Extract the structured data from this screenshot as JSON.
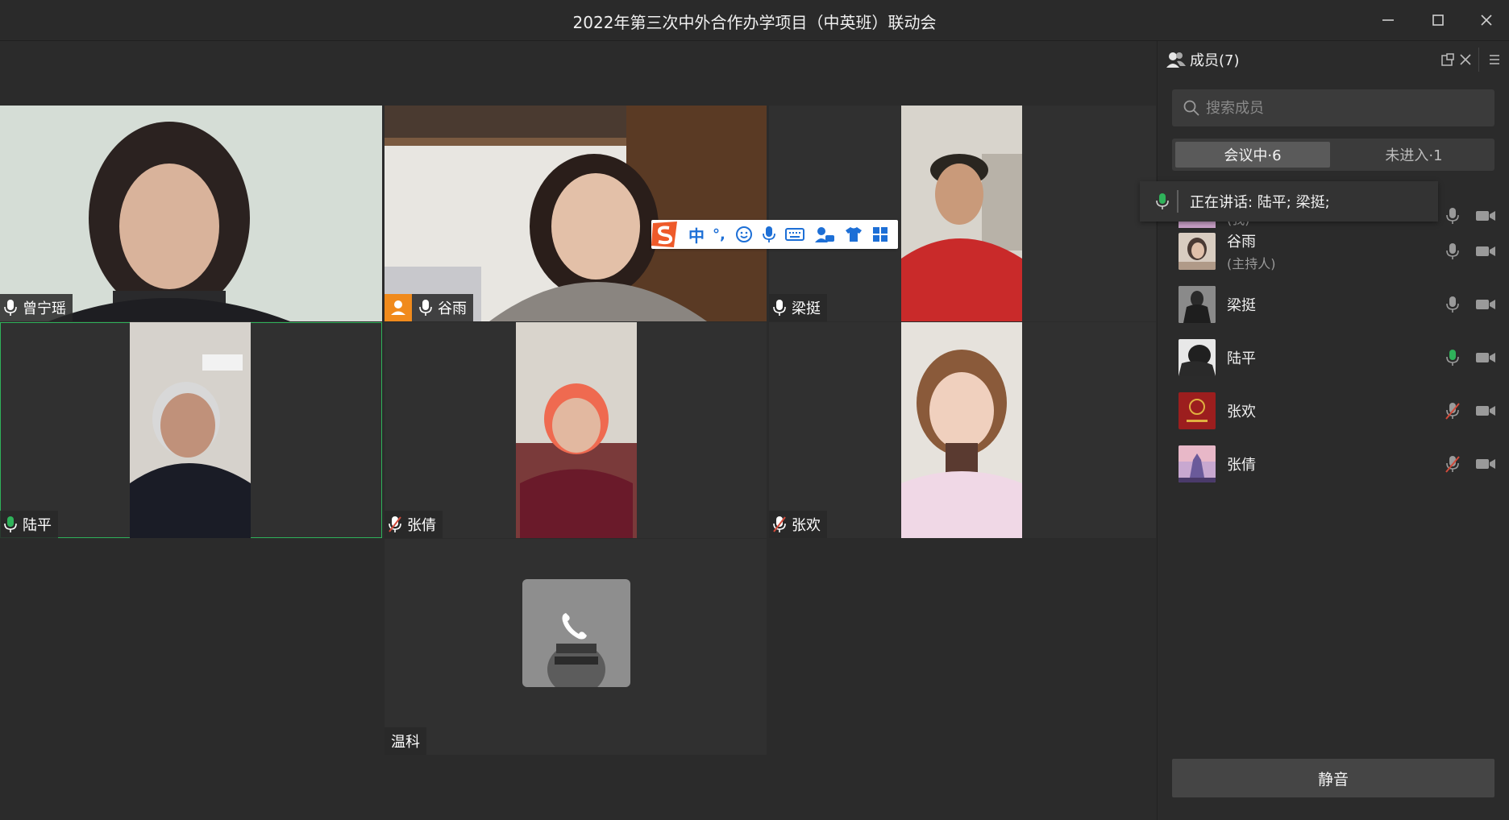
{
  "window": {
    "title": "2022年第三次中外合作办学项目（中英班）联动会"
  },
  "tiles": [
    {
      "name": "曾宁瑶",
      "mic": "on",
      "active": false,
      "host": false
    },
    {
      "name": "谷雨",
      "mic": "on",
      "active": false,
      "host": true
    },
    {
      "name": "梁挺",
      "mic": "on",
      "active": false,
      "host": false
    },
    {
      "name": "陆平",
      "mic": "speaking",
      "active": true,
      "host": false
    },
    {
      "name": "张倩",
      "mic": "muted",
      "active": false,
      "host": false
    },
    {
      "name": "张欢",
      "mic": "muted",
      "active": false,
      "host": false
    },
    {
      "name": "温科",
      "mic": "none",
      "active": false,
      "host": false
    }
  ],
  "ime_toolbar": {
    "mode_char": "中",
    "punct": "°,"
  },
  "panel": {
    "title": "成员(7)",
    "search_placeholder": "搜索成员",
    "tab_in_meeting": "会议中·6",
    "tab_not_joined": "未进入·1",
    "speaking_text": "正在讲话: 陆平; 梁挺;",
    "partial_row_role": "(我)",
    "members": [
      {
        "name": "谷雨",
        "role": "(主持人)",
        "mic": "on"
      },
      {
        "name": "梁挺",
        "role": "",
        "mic": "on"
      },
      {
        "name": "陆平",
        "role": "",
        "mic": "speaking"
      },
      {
        "name": "张欢",
        "role": "",
        "mic": "muted"
      },
      {
        "name": "张倩",
        "role": "",
        "mic": "muted"
      }
    ],
    "mute_all_label": "静音"
  },
  "colors": {
    "background": "#2a2a2a",
    "accent_green": "#2fb25a",
    "host_orange": "#f08a1c",
    "muted_red": "#d24a3a"
  }
}
